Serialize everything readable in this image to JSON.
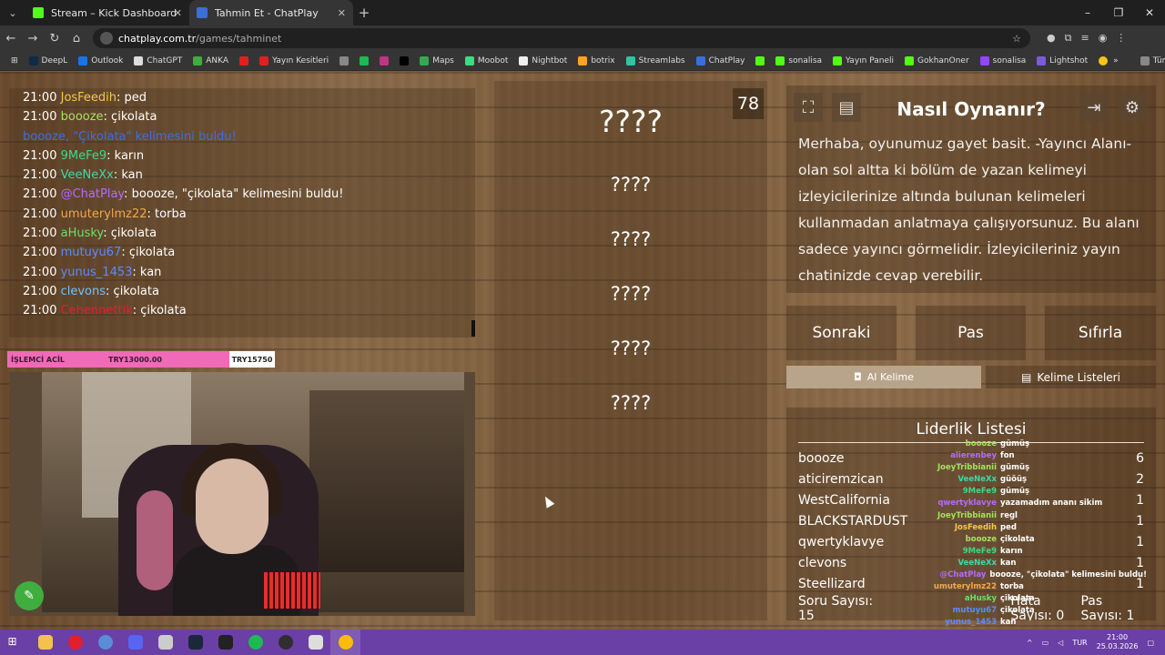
{
  "browser": {
    "tabs": [
      {
        "title": "Stream – Kick Dashboard",
        "favicon_color": "#53fc18",
        "active": false
      },
      {
        "title": "Tahmin Et - ChatPlay",
        "favicon_color": "#3a6fd8",
        "active": true
      }
    ],
    "url_host": "chatplay.com.tr",
    "url_path": "/games/tahminet",
    "bookmarks": [
      "DeepL",
      "Outlook",
      "ChatGPT",
      "ANKA",
      "",
      "Yayın Kesitleri",
      "",
      "",
      "",
      "",
      "Maps",
      "Moobot",
      "Nightbot",
      "botrix",
      "Streamlabs",
      "ChatPlay",
      "",
      "sonalisa",
      "Yayın Paneli",
      "GokhanOner",
      "sonalisa",
      "Lightshot",
      ""
    ],
    "bookmarks_all": "Tüm Yer İşaretleri"
  },
  "chat": {
    "messages": [
      {
        "time": "21:00",
        "user": "JosFeedih",
        "user_color": "#f2c94c",
        "text": ": ped"
      },
      {
        "time": "21:00",
        "user": "boooze",
        "user_color": "#a8e063",
        "text": ": çikolata"
      },
      {
        "time": "",
        "user": "boooze, \"Çikolata\" kelimesini buldu!",
        "user_color": "#3b6fe0",
        "text": ""
      },
      {
        "time": "21:00",
        "user": "9MeFe9",
        "user_color": "#3fd98a",
        "text": ": karın"
      },
      {
        "time": "21:00",
        "user": "VeeNeXx",
        "user_color": "#3fd9a6",
        "text": ": kan"
      },
      {
        "time": "21:00",
        "user": "@ChatPlay",
        "user_color": "#b46bff",
        "text": ": boooze, \"çikolata\" kelimesini buldu!"
      },
      {
        "time": "21:00",
        "user": "umuterylmz22",
        "user_color": "#f2a94c",
        "text": ": torba"
      },
      {
        "time": "21:00",
        "user": "aHusky",
        "user_color": "#6be06b",
        "text": ": çikolata"
      },
      {
        "time": "21:00",
        "user": "mutuyu67",
        "user_color": "#5a8cff",
        "text": ": çikolata"
      },
      {
        "time": "21:00",
        "user": "yunus_1453",
        "user_color": "#5a8cff",
        "text": ": kan"
      },
      {
        "time": "21:00",
        "user": "clevons",
        "user_color": "#6fc3ff",
        "text": ": çikolata"
      },
      {
        "time": "21:00",
        "user": "Cehennettik",
        "user_color": "#e02030",
        "text": ": çikolata"
      }
    ]
  },
  "stream_overlay": {
    "label": "İŞLEMCİ ACİL",
    "goal": "TRY13000.00",
    "current": "TRY15750"
  },
  "game": {
    "counter": "78",
    "main_word": "????",
    "hints": [
      "????",
      "????",
      "????",
      "????",
      "????"
    ]
  },
  "howto": {
    "title": "Nasıl Oynanır?",
    "text": "Merhaba, oyunumuz gayet basit. -Yayıncı Alanı- olan sol altta ki bölüm de yazan kelimeyi izleyicilerinize altında bulunan kelimeleri kullanmadan anlatmaya çalışıyorsunuz. Bu alanı sadece yayıncı görmelidir. İzleyicileriniz yayın chatinizde cevap verebilir."
  },
  "controls": {
    "next": "Sonraki",
    "pass": "Pas",
    "reset": "Sıfırla",
    "ai_word": "AI Kelime",
    "word_lists": "Kelime Listeleri"
  },
  "leaderboard": {
    "title": "Liderlik Listesi",
    "rows": [
      {
        "name": "boooze",
        "score": "6"
      },
      {
        "name": "aticiremzican",
        "score": "2"
      },
      {
        "name": "WestCalifornia",
        "score": "1"
      },
      {
        "name": "BLACKSTARDUST",
        "score": "1"
      },
      {
        "name": "qwertyklavye",
        "score": "1"
      },
      {
        "name": "clevons",
        "score": "1"
      },
      {
        "name": "Steellizard",
        "score": "1"
      }
    ],
    "questions": "Soru Sayısı: 15",
    "errors": "Hata Sayısı: 0",
    "passes": "Pas Sayısı: 1"
  },
  "overlay_chat": [
    {
      "user": "boooze",
      "color": "#a8e063",
      "text": "gümüş"
    },
    {
      "user": "alierenbey",
      "color": "#b46bff",
      "text": "fon"
    },
    {
      "user": "JoeyTribbianii",
      "color": "#a8e063",
      "text": "gümüş"
    },
    {
      "user": "VeeNeXx",
      "color": "#3fd9a6",
      "text": "güöüş"
    },
    {
      "user": "9MeFe9",
      "color": "#3fd98a",
      "text": "gümüş"
    },
    {
      "user": "qwertyklavye",
      "color": "#b46bff",
      "text": "yazamadım ananı sikim"
    },
    {
      "user": "JoeyTribbianii",
      "color": "#a8e063",
      "text": "regl"
    },
    {
      "user": "JosFeedih",
      "color": "#f2c94c",
      "text": "ped"
    },
    {
      "user": "boooze",
      "color": "#a8e063",
      "text": "çikolata"
    },
    {
      "user": "9MeFe9",
      "color": "#3fd98a",
      "text": "karın"
    },
    {
      "user": "VeeNeXx",
      "color": "#3fd9a6",
      "text": "kan"
    },
    {
      "user": "@ChatPlay",
      "color": "#b46bff",
      "text": "boooze, \"çikolata\" kelimesini buldu!"
    },
    {
      "user": "umuterylmz22",
      "color": "#f2a94c",
      "text": "torba"
    },
    {
      "user": "aHusky",
      "color": "#6be06b",
      "text": "çikolata"
    },
    {
      "user": "mutuyu67",
      "color": "#5a8cff",
      "text": "çikolata"
    },
    {
      "user": "yunus_1453",
      "color": "#5a8cff",
      "text": "kan"
    },
    {
      "user": "clevons",
      "color": "#6fc3ff",
      "text": "çikolata"
    },
    {
      "user": "Cehennettik",
      "color": "#e02030",
      "text": "çikolata"
    }
  ],
  "taskbar": {
    "lang": "TUR",
    "time": "21:00",
    "date": "25.03.2026"
  }
}
